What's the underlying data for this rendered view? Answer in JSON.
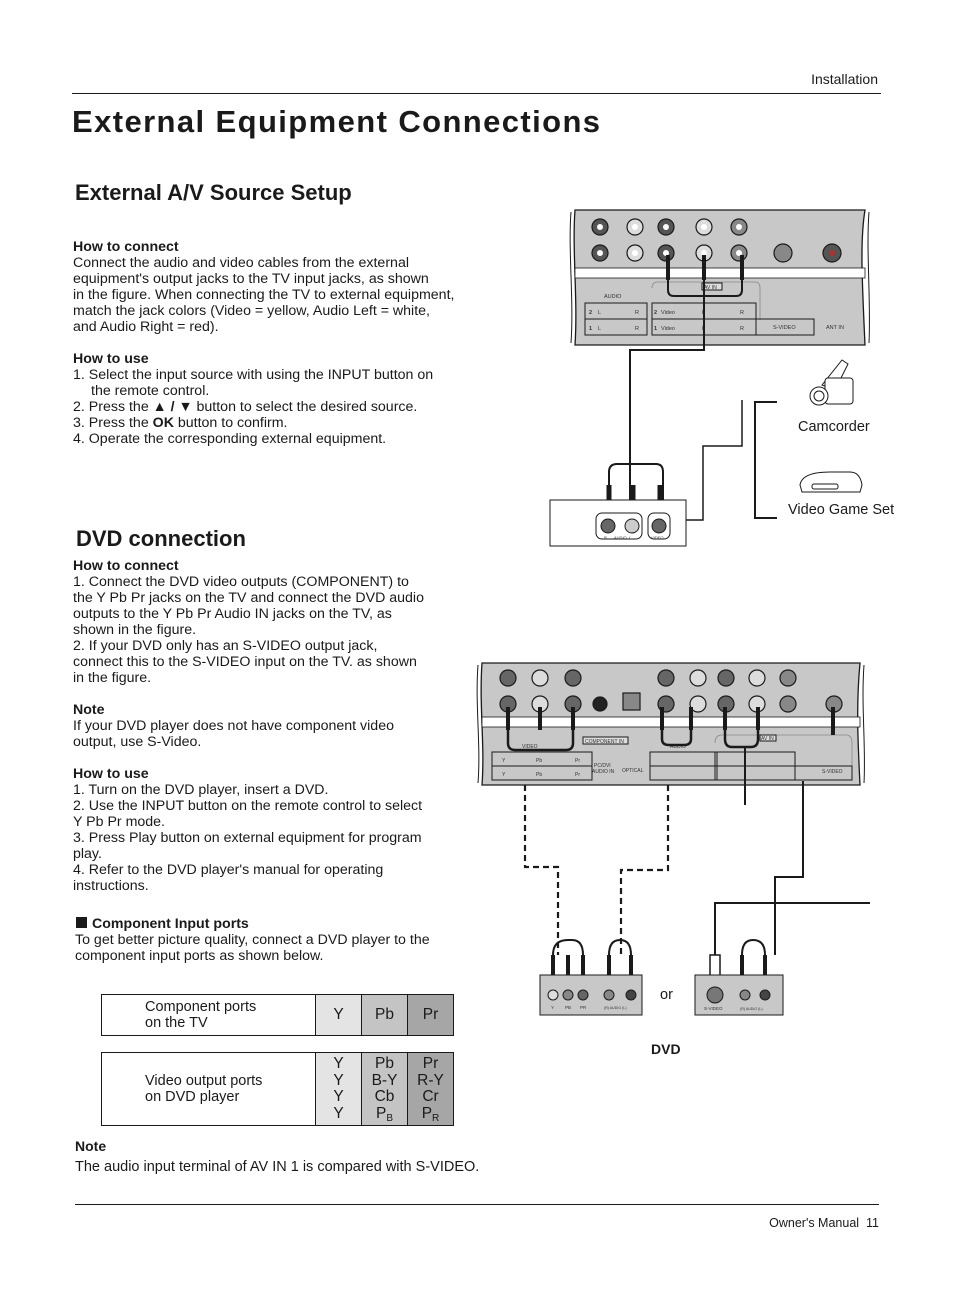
{
  "header": {
    "section": "Installation"
  },
  "title": "External Equipment Connections",
  "av_setup": {
    "heading": "External A/V Source Setup",
    "connect_heading": "How to connect",
    "connect_lines": [
      "Connect the audio and video cables from the external",
      "equipment's output jacks to the TV input jacks, as shown",
      "in the figure. When connecting the TV to external equipment,",
      "match the jack colors (Video = yellow, Audio Left = white,",
      "and Audio Right = red)."
    ],
    "use_heading": "How to use",
    "use_1a": "1. Select the input source with using the INPUT button on",
    "use_1b": "the remote control.",
    "use_2_pre": "2. Press the ",
    "use_2_arrows": "▲ / ▼",
    "use_2_post": " button to select the desired source.",
    "use_3_pre": "3. Press the ",
    "use_3_ok": "OK",
    "use_3_post": " button to confirm.",
    "use_4": "4. Operate the corresponding external equipment."
  },
  "av_diagram": {
    "panel_labels": {
      "audio": "AUDIO",
      "av_in": "AV IN",
      "row2": "2",
      "row1": "1",
      "l": "L",
      "r": "R",
      "video": "Video",
      "svideo": "S-VIDEO",
      "ant_in": "ANT IN"
    },
    "source_labels": {
      "r": "R",
      "audio": "AUDIO",
      "l": "L",
      "video": "VIDEO"
    },
    "devices": [
      "Camcorder",
      "Video Game Set"
    ]
  },
  "dvd": {
    "heading": "DVD connection",
    "connect_heading": "How to connect",
    "connect_lines": [
      "1. Connect the DVD video outputs (COMPONENT) to",
      "the Y Pb Pr jacks on the TV and connect the DVD audio",
      "outputs to the Y Pb Pr Audio IN  jacks on the TV, as",
      "shown in the figure.",
      "2. If your DVD only has an S-VIDEO output jack,",
      "connect  this to  the S-VIDEO input on the TV.  as shown",
      "in the figure."
    ],
    "note_heading": "Note",
    "note_lines": [
      "If your DVD player does not have component video",
      "output, use S-Video."
    ],
    "use_heading": "How to use",
    "use_lines": [
      "1. Turn on the DVD player, insert a DVD.",
      "2. Use the INPUT button on the remote control to select",
      "Y Pb Pr mode.",
      "3. Press Play button on external equipment for program",
      "play.",
      "4. Refer to the DVD player's manual for operating",
      "instructions."
    ],
    "component_heading": "Component Input ports",
    "component_lines": [
      "To get better picture quality, connect a DVD player to the",
      "component input ports as shown below."
    ]
  },
  "port_table": {
    "tv_label": [
      "Component ports",
      "on the TV"
    ],
    "tv_ports": [
      "Y",
      "Pb",
      "Pr"
    ],
    "dvd_label": [
      "Video output ports",
      "on DVD player"
    ],
    "dvd_y": [
      "Y",
      "Y",
      "Y",
      "Y"
    ],
    "dvd_pb": [
      "Pb",
      "B-Y",
      "Cb"
    ],
    "dvd_pb_last": {
      "base": "P",
      "sub": "B"
    },
    "dvd_pr": [
      "Pr",
      "R-Y",
      "Cr"
    ],
    "dvd_pr_last": {
      "base": "P",
      "sub": "R"
    }
  },
  "dvd_diagram": {
    "panel_labels": {
      "video": "VIDEO",
      "component_in": "COMPONENT IN",
      "y": "Y",
      "pb": "Pb",
      "pr": "Pr",
      "pcdvi": "PC/DVI",
      "audio_in": "AUDIO IN",
      "optical": "OPTICAL",
      "audio": "AUDIO",
      "av_in": "AV IN",
      "svideo": "S-VIDEO"
    },
    "dvd_box_labels": {
      "y": "Y",
      "pb": "PB",
      "pr": "PR",
      "audio": "(R) AUDIO (L)",
      "svideo": "S-VIDEO"
    },
    "or": "or",
    "dvd_label": "DVD"
  },
  "footer_note": {
    "heading": "Note",
    "text": "The audio input terminal of AV IN 1 is compared with S-VIDEO."
  },
  "footer": {
    "text": "Owner's Manual",
    "page": "11"
  }
}
